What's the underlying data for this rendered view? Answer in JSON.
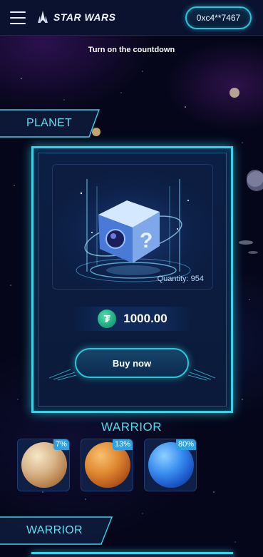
{
  "header": {
    "app_name": "STAR WARS",
    "wallet_address": "0xc4**7467"
  },
  "banner": {
    "countdown_text": "Turn on the countdown"
  },
  "sections": {
    "planet_tag": "PLANET",
    "warrior_tag": "WARRIOR"
  },
  "product": {
    "quantity_text": "Quantity: 954",
    "currency_icon": "tether-icon",
    "price": "1000.00",
    "buy_label": "Buy now"
  },
  "warrior": {
    "title": "WARRIOR",
    "items": [
      {
        "percent": "7%",
        "planet": "beige-gas-giant"
      },
      {
        "percent": "13%",
        "planet": "orange-rocky-planet"
      },
      {
        "percent": "80%",
        "planet": "blue-ocean-planet"
      }
    ]
  },
  "colors": {
    "accent": "#36d3ea",
    "background": "#05061a",
    "badge": "#2f9fe0",
    "coin": "#1ba07a"
  }
}
